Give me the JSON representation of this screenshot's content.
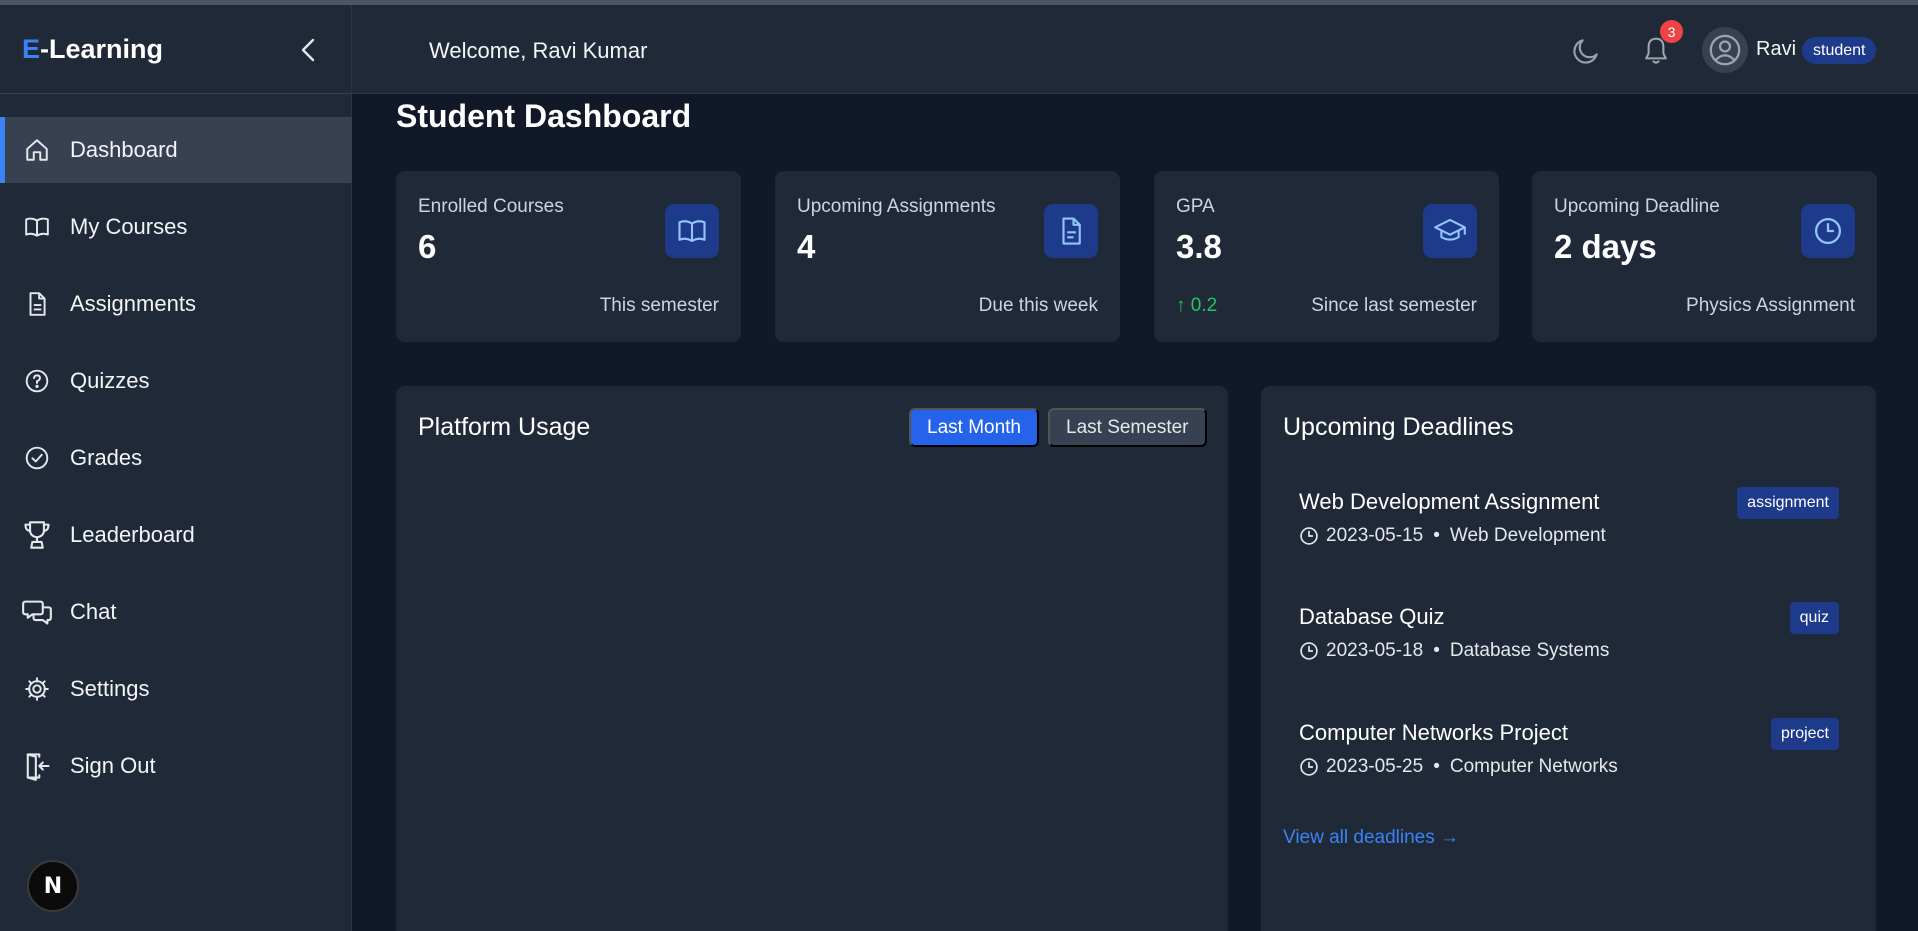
{
  "app": {
    "logo_prefix": "E",
    "logo_rest": "-Learning"
  },
  "sidebar": {
    "items": [
      {
        "label": "Dashboard",
        "icon": "home-icon",
        "active": true
      },
      {
        "label": "My Courses",
        "icon": "book-open-icon"
      },
      {
        "label": "Assignments",
        "icon": "file-text-icon"
      },
      {
        "label": "Quizzes",
        "icon": "help-circle-icon"
      },
      {
        "label": "Grades",
        "icon": "check-circle-icon"
      },
      {
        "label": "Leaderboard",
        "icon": "trophy-icon"
      },
      {
        "label": "Chat",
        "icon": "chat-bubbles-icon"
      },
      {
        "label": "Settings",
        "icon": "gear-icon"
      },
      {
        "label": "Sign Out",
        "icon": "sign-out-icon"
      }
    ],
    "footer_badge": "N"
  },
  "header": {
    "welcome": "Welcome, Ravi Kumar",
    "notification_count": "3",
    "user_name": "Ravi",
    "role": "student"
  },
  "page": {
    "title": "Student Dashboard"
  },
  "stats": [
    {
      "label": "Enrolled Courses",
      "value": "6",
      "sub": "This semester",
      "icon": "book-open-icon"
    },
    {
      "label": "Upcoming Assignments",
      "value": "4",
      "sub": "Due this week",
      "icon": "file-text-icon"
    },
    {
      "label": "GPA",
      "value": "3.8",
      "trend": "↑ 0.2",
      "sub": "Since last semester",
      "icon": "graduation-cap-icon"
    },
    {
      "label": "Upcoming Deadline",
      "value": "2 days",
      "sub": "Physics Assignment",
      "icon": "clock-icon"
    }
  ],
  "usage": {
    "title": "Platform Usage",
    "buttons": [
      "Last Month",
      "Last Semester"
    ]
  },
  "deadlines": {
    "title": "Upcoming Deadlines",
    "items": [
      {
        "title": "Web Development Assignment",
        "date": "2023-05-15",
        "dot": "•",
        "course": "Web Development",
        "tag": "assignment"
      },
      {
        "title": "Database Quiz",
        "date": "2023-05-18",
        "dot": "•",
        "course": "Database Systems",
        "tag": "quiz"
      },
      {
        "title": "Computer Networks Project",
        "date": "2023-05-25",
        "dot": "•",
        "course": "Computer Networks",
        "tag": "project"
      }
    ],
    "view_all": "View all deadlines →"
  },
  "colors": {
    "accent": "#3b82f6",
    "sidebar_bg": "#1f2937",
    "page_bg": "#111827",
    "badge_bg": "#1e3a8a",
    "trend_up": "#22c55e",
    "alert": "#ef4444"
  }
}
